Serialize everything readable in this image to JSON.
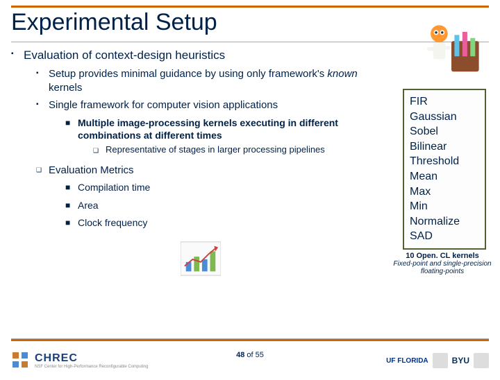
{
  "title": "Experimental Setup",
  "bullet_lvl1": "Evaluation of context-design heuristics",
  "sub1_a_pre": "Setup provides minimal guidance by using only framework's ",
  "sub1_a_known": "known",
  "sub1_a_post": " kernels",
  "sub1_b": "Single framework for computer vision applications",
  "sub2_a": "Multiple image-processing kernels executing in different combinations at different times",
  "sub3_a": "Representative of stages in larger processing pipelines",
  "metrics_heading": "Evaluation Metrics",
  "metric_1": "Compilation time",
  "metric_2": "Area",
  "metric_3": "Clock frequency",
  "kernels": [
    "FIR",
    "Gaussian",
    "Sobel",
    "Bilinear",
    "Threshold",
    "Mean",
    "Max",
    "Min",
    "Normalize",
    "SAD"
  ],
  "kernel_caption_bold": "10 Open. CL kernels",
  "kernel_caption_italic": "Fixed-point and single-precision floating-points",
  "page_current": "48",
  "page_of": "of",
  "page_total": "55",
  "logos": {
    "chrec": "CHREC",
    "chrec_sub": "NSF Center for High-Performance Reconfigurable Computing",
    "uf": "UF FLORIDA",
    "byu": "BYU"
  }
}
